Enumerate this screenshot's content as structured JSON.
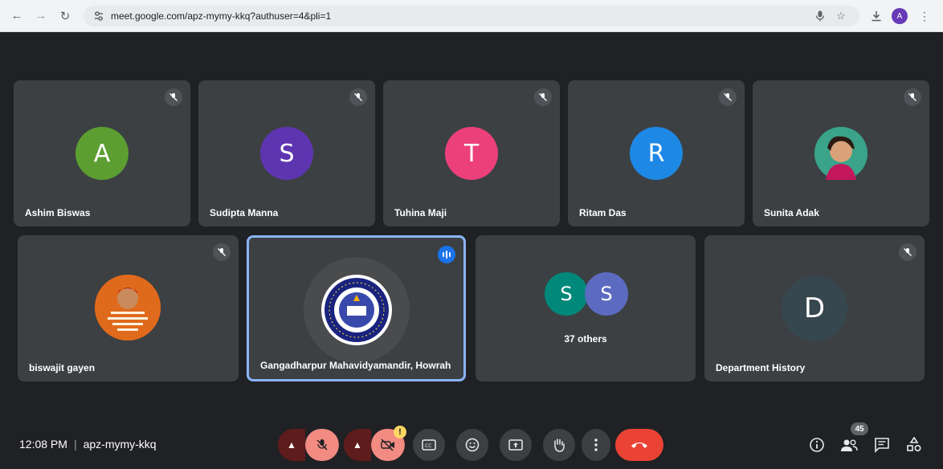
{
  "browser": {
    "url": "meet.google.com/apz-mymy-kkq?authuser=4&pli=1",
    "profile_initial": "A",
    "profile_color": "#673ab7"
  },
  "tiles_row1": [
    {
      "name": "Ashim Biswas",
      "initial": "A",
      "color": "#5c9e31",
      "muted": true
    },
    {
      "name": "Sudipta Manna",
      "initial": "S",
      "color": "#5e35b1",
      "muted": true
    },
    {
      "name": "Tuhina Maji",
      "initial": "T",
      "color": "#ec407a",
      "muted": true
    },
    {
      "name": "Ritam Das",
      "initial": "R",
      "color": "#1e88e5",
      "muted": true
    },
    {
      "name": "Sunita Adak",
      "initial": "",
      "photo": "profile-photo",
      "muted": true
    }
  ],
  "tiles_row2": [
    {
      "name": "biswajit gayen",
      "photo": "profile-photo",
      "muted": true
    },
    {
      "name": "Gangadharpur Mahavidyamandir, Howrah",
      "photo": "college-emblem",
      "speaking": true
    },
    {
      "others_label": "37 others",
      "initials": [
        "S",
        "S"
      ],
      "colors": [
        "#00897b",
        "#5c6bc0"
      ]
    },
    {
      "name": "Department History",
      "initial": "D",
      "color": "#37474f",
      "muted": true
    }
  ],
  "bottom": {
    "time": "12:08 PM",
    "meeting_code": "apz-mymy-kkq",
    "people_count": "45",
    "warning_badge": "!"
  },
  "colors": {
    "background": "#202124",
    "tile": "#3c4043",
    "end_call": "#ea4335",
    "muted_control": "#f28b82",
    "speaking_border": "#8ab4f8"
  }
}
